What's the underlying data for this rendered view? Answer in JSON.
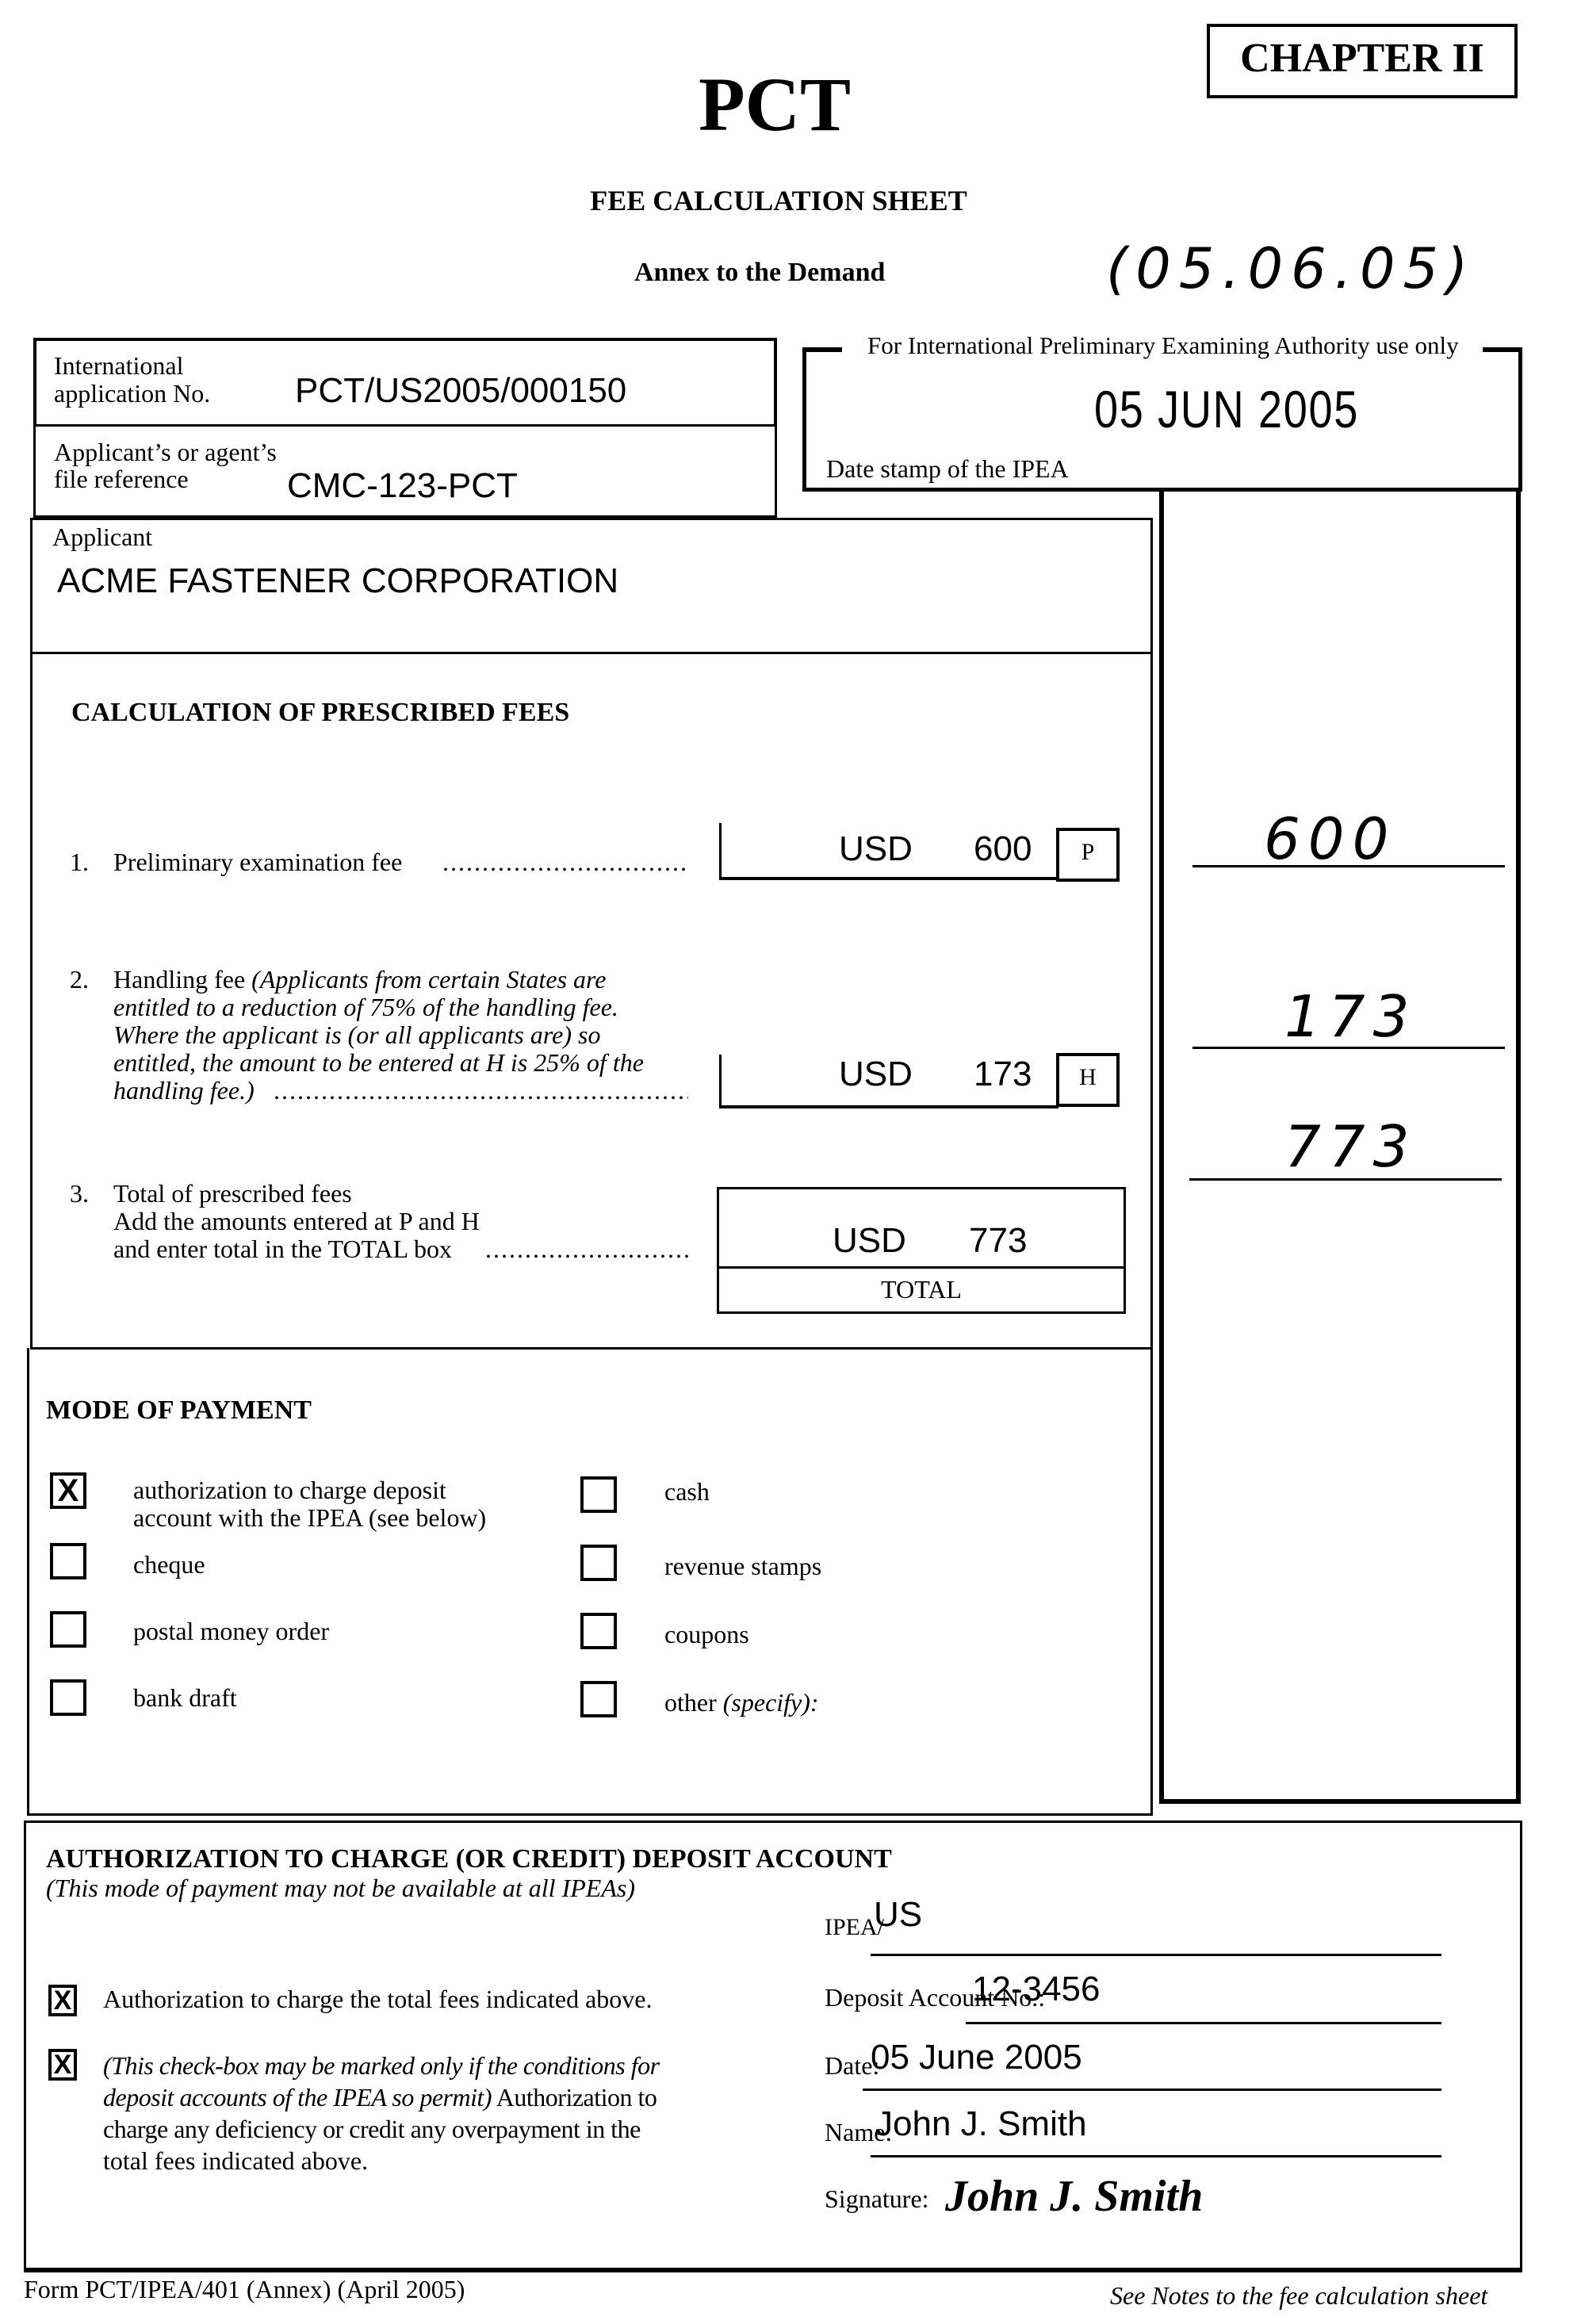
{
  "header": {
    "chapter": "CHAPTER II",
    "title": "PCT",
    "subtitle": "FEE CALCULATION SHEET",
    "annex": "Annex to the Demand",
    "handwritten_date": "(05.06.05)"
  },
  "application": {
    "intl_app_label_1": "International",
    "intl_app_label_2": "application No.",
    "intl_app_no": "PCT/US2005/000150",
    "file_ref_label_1": "Applicant’s or agent’s",
    "file_ref_label_2": "file reference",
    "file_ref": "CMC-123-PCT",
    "applicant_label": "Applicant",
    "applicant": "ACME FASTENER CORPORATION"
  },
  "ipea_box": {
    "heading": "For International Preliminary Examining Authority use only",
    "date_stamp": "05 JUN 2005",
    "date_stamp_label": "Date stamp of the IPEA"
  },
  "fees": {
    "heading": "CALCULATION OF PRESCRIBED FEES",
    "items": [
      {
        "number": "1.",
        "label": "Preliminary examination fee",
        "note": "",
        "leader": "....................................",
        "currency": "USD",
        "amount": "600",
        "code": "P",
        "ipea_amount": "600"
      },
      {
        "number": "2.",
        "label": "Handling fee",
        "note_lines": [
          "(Applicants from certain States are",
          "entitled to a reduction of 75% of the handling fee.",
          "Where the applicant is (or all applicants are) so",
          "entitled, the amount to be entered at H is 25% of the",
          "handling fee.)"
        ],
        "leader": "...........................................................",
        "currency": "USD",
        "amount": "173",
        "code": "H",
        "ipea_amount": "173"
      },
      {
        "number": "3.",
        "label": "Total of prescribed fees",
        "line2": "Add the amounts entered at P and H",
        "line3": "and enter total in the TOTAL box",
        "leader": "...............................",
        "currency": "USD",
        "amount": "773",
        "code": "TOTAL",
        "ipea_amount": "773"
      }
    ]
  },
  "payment": {
    "heading": "MODE OF PAYMENT",
    "left": [
      {
        "label_1": "authorization to charge deposit",
        "label_2": "account with the IPEA (see below)",
        "checked": true
      },
      {
        "label_1": "cheque",
        "checked": false
      },
      {
        "label_1": "postal money order",
        "checked": false
      },
      {
        "label_1": "bank draft",
        "checked": false
      }
    ],
    "right": [
      {
        "label_1": "cash",
        "checked": false
      },
      {
        "label_1": "revenue stamps",
        "checked": false
      },
      {
        "label_1": "coupons",
        "checked": false
      },
      {
        "label_1": "other",
        "label_italic": "(specify):",
        "checked": false
      }
    ],
    "check_mark": "X"
  },
  "authorization": {
    "heading": "AUTHORIZATION TO CHARGE (OR CREDIT) DEPOSIT ACCOUNT",
    "subheading": "(This mode of payment may not be available at all IPEAs)",
    "check1_label": "Authorization to charge the total fees indicated above.",
    "check1_checked": true,
    "check2_italic_1": "(This check-box may be marked only if the conditions for",
    "check2_italic_2": "deposit accounts of the IPEA so permit)",
    "check2_rest_2": " Authorization to",
    "check2_line3": "charge any deficiency or credit any overpayment in the",
    "check2_line4": "total fees indicated above.",
    "check2_checked": true,
    "ipea_label": "IPEA/",
    "ipea_value": "US",
    "deposit_label": "Deposit Account No.:",
    "deposit_value": "12-3456",
    "date_label": "Date:",
    "date_value": "05 June 2005",
    "name_label": "Name:",
    "name_value": "John J. Smith",
    "signature_label": "Signature:",
    "signature_value": "John J. Smith"
  },
  "footer": {
    "form_id": "Form PCT/IPEA/401 (Annex) (April 2005)",
    "notes": "See Notes to the fee calculation sheet"
  }
}
